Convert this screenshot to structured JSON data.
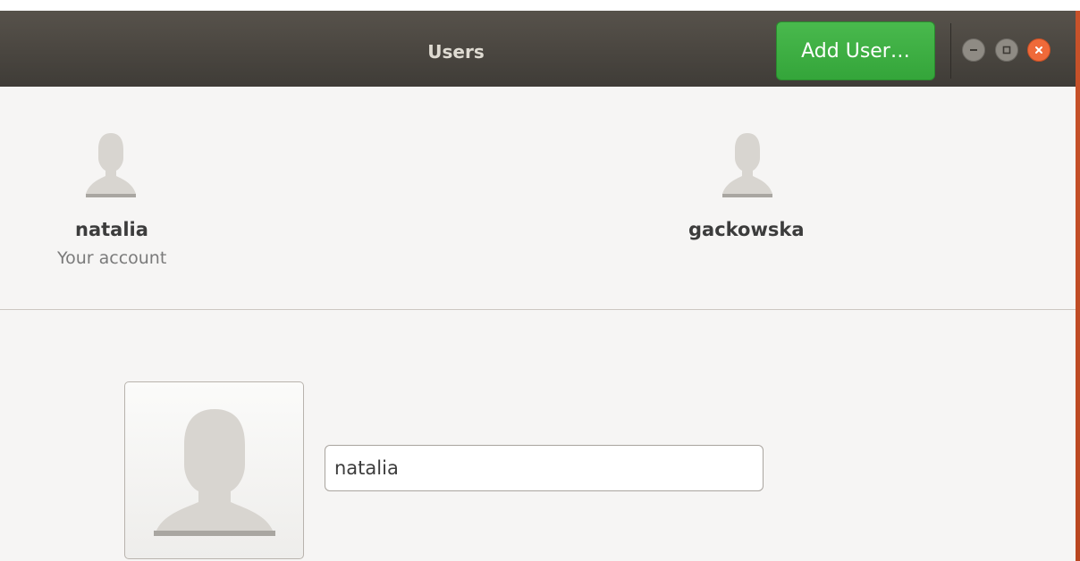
{
  "window": {
    "title": "Users",
    "add_user_label": "Add User…"
  },
  "users": [
    {
      "name": "natalia",
      "subtitle": "Your account"
    },
    {
      "name": "gackowska",
      "subtitle": ""
    }
  ],
  "details": {
    "name_value": "natalia"
  },
  "colors": {
    "header_bg": "#48443e",
    "add_button": "#3eaf43",
    "close_button": "#ef6a3a",
    "content_bg": "#f6f5f4"
  },
  "icons": {
    "avatar": "user-avatar-icon",
    "minimize": "minimize-icon",
    "maximize": "maximize-icon",
    "close": "close-icon"
  }
}
